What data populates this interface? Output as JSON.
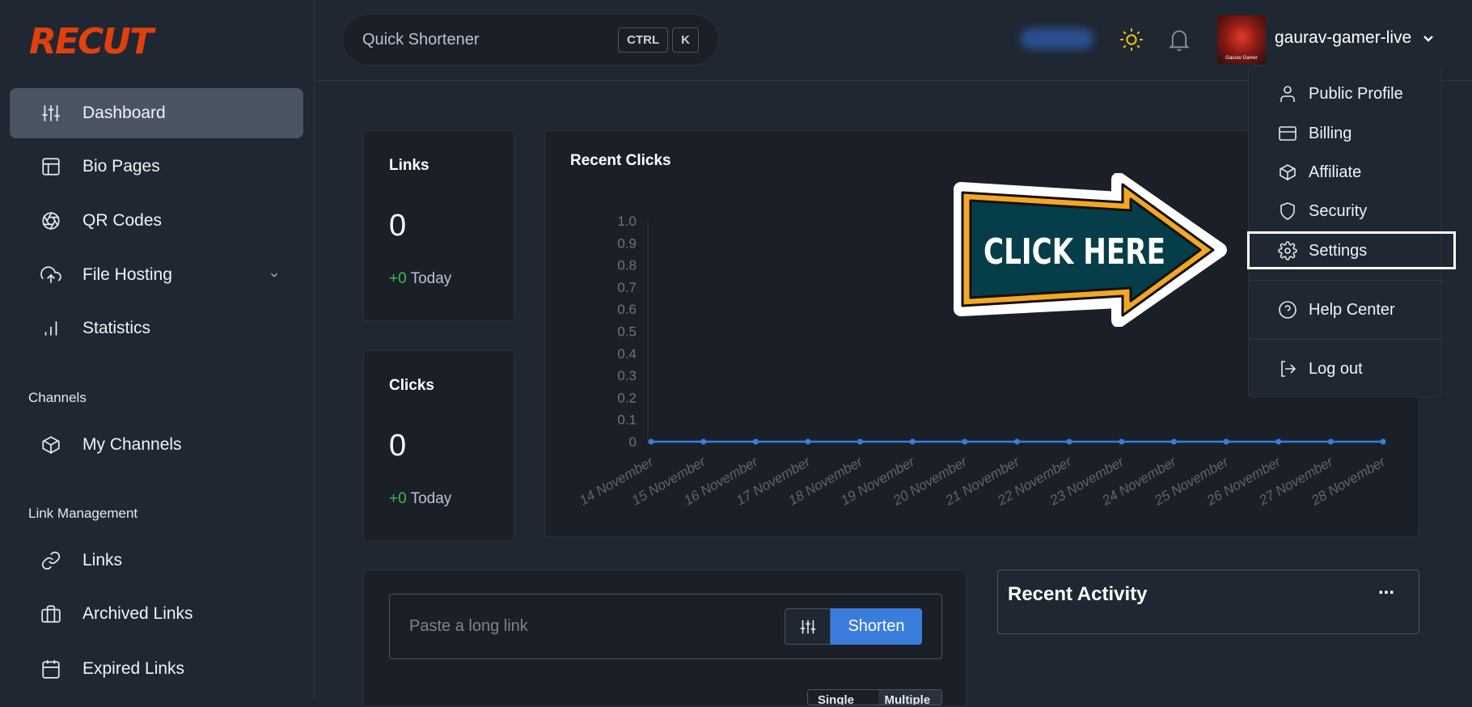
{
  "app": {
    "logo": "RECUT",
    "brand_color": "#e0400e",
    "accent": "#3b7ddd"
  },
  "sidebar": {
    "items": [
      {
        "label": "Dashboard",
        "icon": "sliders-icon",
        "active": true
      },
      {
        "label": "Bio Pages",
        "icon": "layout-icon"
      },
      {
        "label": "QR Codes",
        "icon": "aperture-icon"
      },
      {
        "label": "File Hosting",
        "icon": "upload-cloud-icon",
        "chevron": true
      },
      {
        "label": "Statistics",
        "icon": "bar-chart-icon"
      }
    ],
    "channels_title": "Channels",
    "channels": [
      {
        "label": "My Channels",
        "icon": "box-icon"
      }
    ],
    "link_mgmt_title": "Link Management",
    "link_mgmt": [
      {
        "label": "Links",
        "icon": "link-icon"
      },
      {
        "label": "Archived Links",
        "icon": "briefcase-icon"
      },
      {
        "label": "Expired Links",
        "icon": "calendar-icon"
      }
    ]
  },
  "header": {
    "search_placeholder": "Quick Shortener",
    "kbd1": "CTRL",
    "kbd2": "K",
    "username": "gaurav-gamer-live",
    "avatar_text": "Gaurav Gamer"
  },
  "dropdown": {
    "items": [
      {
        "label": "Public Profile"
      },
      {
        "label": "Billing"
      },
      {
        "label": "Affiliate"
      },
      {
        "label": "Security"
      },
      {
        "label": "Settings",
        "highlighted": true
      },
      {
        "label": "Help Center"
      },
      {
        "label": "Log out"
      }
    ]
  },
  "annotation": {
    "text": "CLICK HERE"
  },
  "stats": {
    "links": {
      "title": "Links",
      "value": "0",
      "delta": "+0",
      "today": "Today"
    },
    "clicks": {
      "title": "Clicks",
      "value": "0",
      "delta": "+0",
      "today": "Today"
    }
  },
  "recent_clicks": {
    "title": "Recent Clicks"
  },
  "chart_data": {
    "type": "line",
    "categories": [
      "14 November",
      "15 November",
      "16 November",
      "17 November",
      "18 November",
      "19 November",
      "20 November",
      "21 November",
      "22 November",
      "23 November",
      "24 November",
      "25 November",
      "26 November",
      "27 November",
      "28 November"
    ],
    "values": [
      0,
      0,
      0,
      0,
      0,
      0,
      0,
      0,
      0,
      0,
      0,
      0,
      0,
      0,
      0
    ],
    "ylim": [
      0,
      1
    ],
    "yticks": [
      "0",
      "0.1",
      "0.2",
      "0.3",
      "0.4",
      "0.5",
      "0.6",
      "0.7",
      "0.8",
      "0.9",
      "1.0"
    ],
    "color": "#3b7ddd"
  },
  "shortener": {
    "placeholder": "Paste a long link",
    "button": "Shorten",
    "toggle": [
      "Single",
      "Multiple"
    ]
  },
  "recent_activity": {
    "title": "Recent Activity",
    "more": "..."
  }
}
